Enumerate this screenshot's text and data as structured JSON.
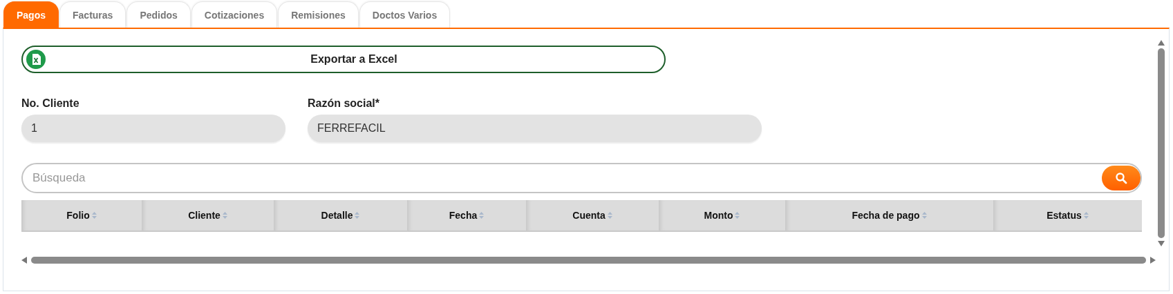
{
  "tabs": [
    {
      "label": "Pagos",
      "selected": true
    },
    {
      "label": "Facturas",
      "selected": false
    },
    {
      "label": "Pedidos",
      "selected": false
    },
    {
      "label": "Cotizaciones",
      "selected": false
    },
    {
      "label": "Remisiones",
      "selected": false
    },
    {
      "label": "Doctos Varios",
      "selected": false
    }
  ],
  "export_button": {
    "label": "Exportar a Excel"
  },
  "fields": [
    {
      "label": "No. Cliente",
      "value": "1"
    },
    {
      "label": "Razón social*",
      "value": "FERREFACIL"
    }
  ],
  "search": {
    "placeholder": "Búsqueda"
  },
  "table": {
    "columns": [
      "Folio",
      "Cliente",
      "Detalle",
      "Fecha",
      "Cuenta",
      "Monto",
      "Fecha de pago",
      "Estatus"
    ]
  }
}
